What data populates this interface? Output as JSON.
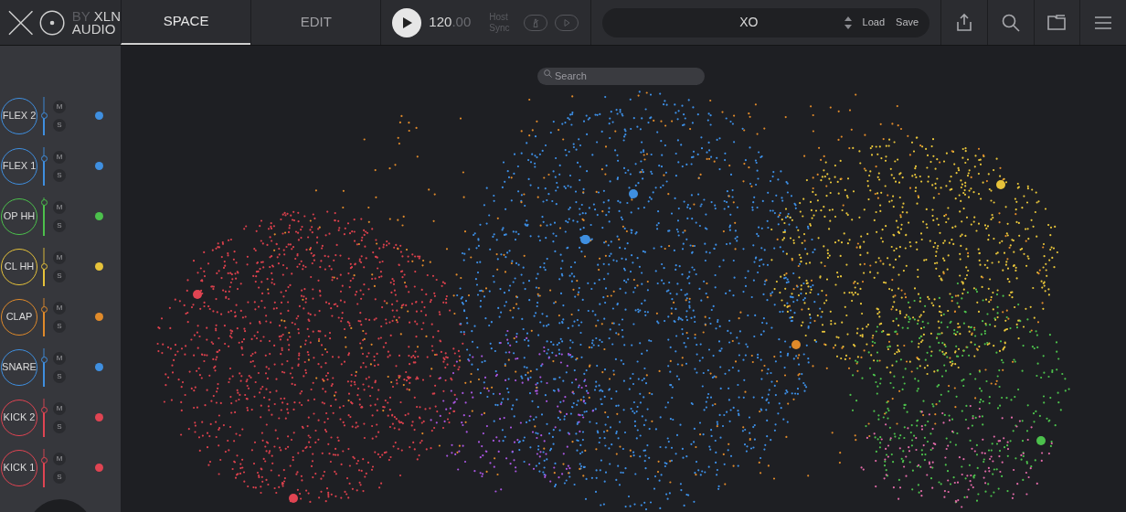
{
  "logo": {
    "by": "BY",
    "brand": "XLN",
    "sub": "AUDIO"
  },
  "tabs": [
    {
      "label": "SPACE",
      "selected": true
    },
    {
      "label": "EDIT",
      "selected": false
    }
  ],
  "transport": {
    "tempo": "120",
    "tempo_fraction": ".00",
    "host_sync": "Host Sync"
  },
  "preset": {
    "name": "XO",
    "load": "Load",
    "save": "Save"
  },
  "search": {
    "placeholder": "Search"
  },
  "channels": [
    {
      "name": "FLEX 2",
      "color": "#3f8fe0",
      "level": 0.5,
      "mute": "M",
      "solo": "S"
    },
    {
      "name": "FLEX 1",
      "color": "#3f8fe0",
      "level": 0.7,
      "mute": "M",
      "solo": "S"
    },
    {
      "name": "OP HH",
      "color": "#4cc04c",
      "level": 0.85,
      "mute": "M",
      "solo": "S"
    },
    {
      "name": "CL HH",
      "color": "#e6c23a",
      "level": 0.5,
      "mute": "M",
      "solo": "S"
    },
    {
      "name": "CLAP",
      "color": "#e08a2a",
      "level": 0.7,
      "mute": "M",
      "solo": "S"
    },
    {
      "name": "SNARE",
      "color": "#3f8fe0",
      "level": 0.7,
      "mute": "M",
      "solo": "S"
    },
    {
      "name": "KICK 2",
      "color": "#e04452",
      "level": 0.7,
      "mute": "M",
      "solo": "S"
    },
    {
      "name": "KICK 1",
      "color": "#e04452",
      "level": 0.7,
      "mute": "M",
      "solo": "S"
    }
  ]
}
